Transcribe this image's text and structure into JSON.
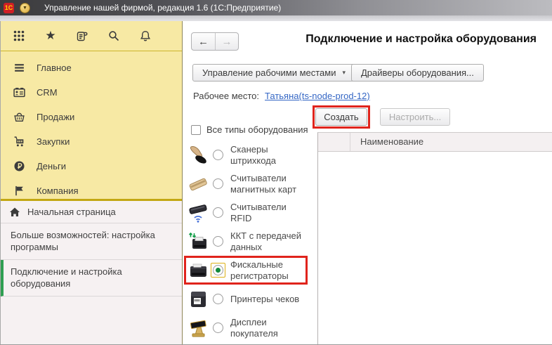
{
  "window": {
    "title": "Управление нашей фирмой, редакция 1.6  (1С:Предприятие)",
    "logo": "1С"
  },
  "icons": {
    "dropdown_arrow": "▾",
    "back_arrow": "←",
    "forward_arrow": "→",
    "star": "★",
    "menu_circle_arrow": "▼"
  },
  "sidebar": {
    "toolbar": [
      {
        "name": "apps-grid"
      },
      {
        "name": "favorites-star"
      },
      {
        "name": "history-scroll"
      },
      {
        "name": "search"
      },
      {
        "name": "notifications-bell"
      }
    ],
    "menu": [
      {
        "label": "Главное"
      },
      {
        "label": "CRM"
      },
      {
        "label": "Продажи"
      },
      {
        "label": "Закупки"
      },
      {
        "label": "Деньги"
      },
      {
        "label": "Компания"
      }
    ],
    "pages": [
      {
        "label": "Начальная страница"
      },
      {
        "label": "Больше возможностей: настройка программы"
      },
      {
        "label": "Подключение и настройка оборудования",
        "active": true
      }
    ]
  },
  "main": {
    "title": "Подключение и настройка оборудования",
    "workplaces_button": "Управление рабочими местами",
    "drivers_button": "Драйверы оборудования...",
    "workplace_label": "Рабочее место:",
    "workplace_link": "Татьяна(ts-node-prod-12)",
    "create_button": "Создать",
    "configure_button": "Настроить...",
    "all_types_label": "Все типы оборудования",
    "equipment_types": [
      "Сканеры штрихкода",
      "Считыватели магнитных карт",
      "Считыватели RFID",
      "ККТ с передачей данных",
      "Фискальные регистраторы",
      "Принтеры чеков",
      "Дисплеи покупателя"
    ],
    "selected_equipment": "Фискальные регистраторы",
    "table": {
      "name_column": "Наименование"
    }
  },
  "colors": {
    "sidebar_yellow": "#f7e9a4",
    "annotation_red": "#e0241c",
    "active_green": "#2f9e51",
    "link_blue": "#3567c5"
  }
}
